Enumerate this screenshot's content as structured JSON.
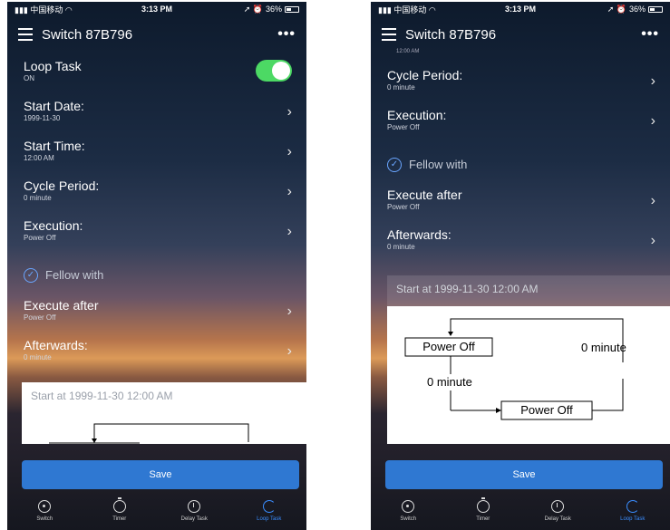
{
  "status": {
    "carrier": "中国移动",
    "time": "3:13 PM",
    "battery": "36%"
  },
  "nav": {
    "title": "Switch 87B796"
  },
  "screen1": {
    "loop_task": {
      "label": "Loop Task",
      "value": "ON"
    },
    "rows": [
      {
        "label": "Start Date:",
        "value": "1999-11-30"
      },
      {
        "label": "Start Time:",
        "value": "12:00 AM"
      },
      {
        "label": "Cycle Period:",
        "value": "0 minute"
      },
      {
        "label": "Execution:",
        "value": "Power Off"
      }
    ],
    "fellow_label": "Fellow with",
    "rows2": [
      {
        "label": "Execute after",
        "value": "Power Off"
      },
      {
        "label": "Afterwards:",
        "value": "0 minute"
      }
    ],
    "diagram_caption": "Start at 1999-11-30 12:00 AM"
  },
  "screen2": {
    "partial_top": "12:00 AM",
    "rows": [
      {
        "label": "Cycle Period:",
        "value": "0 minute"
      },
      {
        "label": "Execution:",
        "value": "Power Off"
      }
    ],
    "fellow_label": "Fellow with",
    "rows2": [
      {
        "label": "Execute after",
        "value": "Power Off"
      },
      {
        "label": "Afterwards:",
        "value": "0 minute"
      }
    ],
    "diagram": {
      "caption": "Start at 1999-11-30 12:00 AM",
      "box1": "Power Off",
      "label_right": "0 minute",
      "label_left": "0 minute",
      "box2": "Power Off"
    }
  },
  "save_label": "Save",
  "tabs": [
    {
      "label": "Switch",
      "icon": "power-icon"
    },
    {
      "label": "Timer",
      "icon": "timer-icon"
    },
    {
      "label": "Delay Task",
      "icon": "clock-icon"
    },
    {
      "label": "Loop Task",
      "icon": "loop-icon",
      "active": true
    }
  ]
}
